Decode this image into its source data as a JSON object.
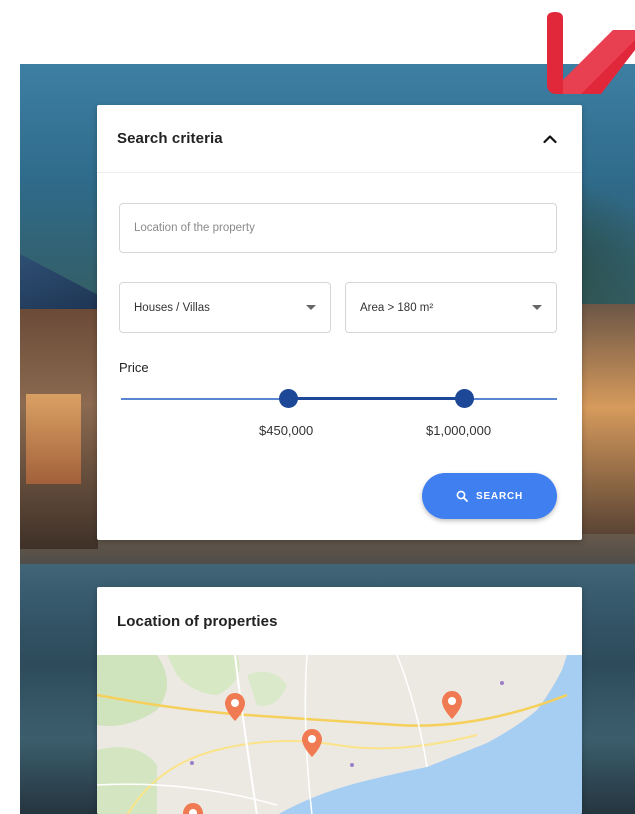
{
  "search_card": {
    "title": "Search criteria",
    "location_placeholder": "Location of the property",
    "property_type": {
      "selected": "Houses / Villas"
    },
    "area": {
      "selected": "Area > 180 m²"
    },
    "price": {
      "label": "Price",
      "min_value": "$450,000",
      "max_value": "$1,000,000"
    },
    "search_button_label": "SEARCH"
  },
  "map_card": {
    "title": "Location of properties",
    "markers": [
      "marker-1",
      "marker-2",
      "marker-3",
      "marker-4"
    ]
  },
  "colors": {
    "accent": "#3f7ff0",
    "slider": "#1d4897",
    "marker": "#f07a52",
    "brand": "#e0283a"
  }
}
